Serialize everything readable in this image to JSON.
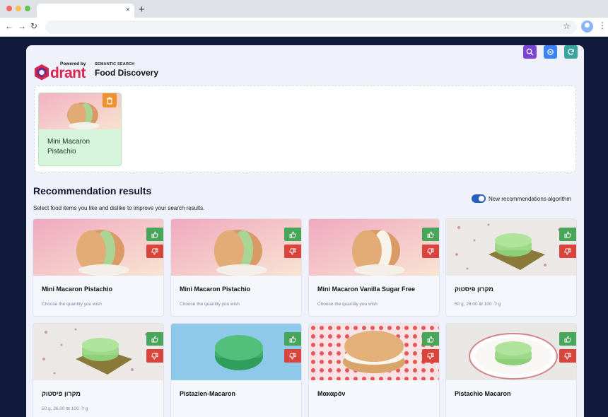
{
  "browser": {
    "new_tab": "+",
    "tab_close": "×"
  },
  "colors": {
    "search_button": "#7a45d6",
    "settings_button": "#3b82f6",
    "refresh_button": "#38a69c",
    "like": "#48a65a",
    "dislike": "#d9453d",
    "trash": "#f0912d",
    "brand": "#dc244c",
    "toggle": "#285ec0"
  },
  "header": {
    "powered_by": "Powered by",
    "brand": "drant",
    "subtitle": "SEMANTIC SEARCH",
    "title": "Food Discovery"
  },
  "selected": {
    "items": [
      {
        "name": "Mini Macaron Pistachio",
        "image": "pink-macaron-pistachio"
      }
    ]
  },
  "recommendations": {
    "title": "Recommendation results",
    "subtitle": "Select food items you like and dislike to improve your search results.",
    "toggle_label": "New recommendations algorithm",
    "toggle_on": true,
    "items": [
      {
        "name": "Mini Macaron Pistachio",
        "desc": "Choose the quantity you wish",
        "image": "pink-bg-green-filling"
      },
      {
        "name": "Mini Macaron Pistachio",
        "desc": "Choose the quantity you wish",
        "image": "pink-bg-green-filling"
      },
      {
        "name": "Mini Macaron Vanilla Sugar Free",
        "desc": "Choose the quantity you wish",
        "image": "pink-bg-white-filling"
      },
      {
        "name": "מקרון פיסטוק",
        "desc": "50 g, 26.00 ₪ ל- 100 g",
        "image": "speckled-green-macaron"
      },
      {
        "name": "מקרון פיסטוק",
        "desc": "50 g, 26.00 ₪ ל- 100 g",
        "image": "speckled-green-macaron"
      },
      {
        "name": "Pistazien-Macaron",
        "desc": "",
        "image": "blue-bg-green-macaron"
      },
      {
        "name": "Μακαρόν",
        "desc": "",
        "image": "polka-dot-macaron"
      },
      {
        "name": "Pistachio Macaron",
        "desc": "",
        "image": "plate-green-macaron"
      }
    ]
  }
}
